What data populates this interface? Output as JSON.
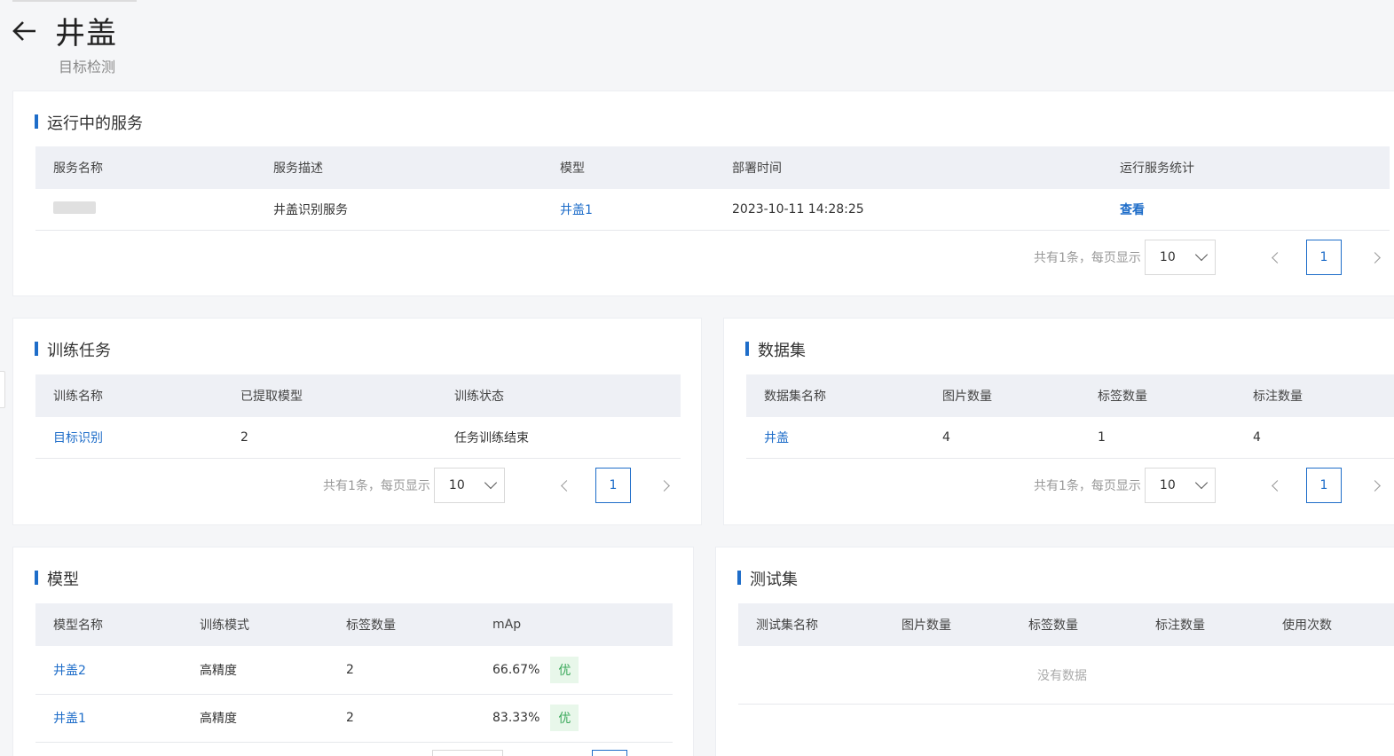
{
  "header": {
    "title": "井盖",
    "subtitle": "目标检测"
  },
  "services": {
    "title": "运行中的服务",
    "columns": [
      "服务名称",
      "服务描述",
      "模型",
      "部署时间",
      "运行服务统计"
    ],
    "rows": [
      {
        "name": "",
        "desc": "井盖识别服务",
        "model": "井盖1",
        "time": "2023-10-11 14:28:25",
        "stats": "查看"
      }
    ],
    "pager": {
      "total": "共有1条，每页显示",
      "size": "10",
      "page": "1"
    }
  },
  "training": {
    "title": "训练任务",
    "columns": [
      "训练名称",
      "已提取模型",
      "训练状态"
    ],
    "rows": [
      {
        "name": "目标识别",
        "models": "2",
        "status": "任务训练结束"
      }
    ],
    "pager": {
      "total": "共有1条，每页显示",
      "size": "10",
      "page": "1"
    }
  },
  "datasets": {
    "title": "数据集",
    "columns": [
      "数据集名称",
      "图片数量",
      "标签数量",
      "标注数量"
    ],
    "rows": [
      {
        "name": "井盖",
        "images": "4",
        "labels": "1",
        "annotations": "4"
      }
    ],
    "pager": {
      "total": "共有1条，每页显示",
      "size": "10",
      "page": "1"
    }
  },
  "models": {
    "title": "模型",
    "columns": [
      "模型名称",
      "训练模式",
      "标签数量",
      "mAp"
    ],
    "rows": [
      {
        "name": "井盖2",
        "mode": "高精度",
        "labels": "2",
        "map": "66.67%",
        "grade": "优"
      },
      {
        "name": "井盖1",
        "mode": "高精度",
        "labels": "2",
        "map": "83.33%",
        "grade": "优"
      }
    ]
  },
  "testsets": {
    "title": "测试集",
    "columns": [
      "测试集名称",
      "图片数量",
      "标签数量",
      "标注数量",
      "使用次数"
    ],
    "empty": "没有数据"
  },
  "colors": {
    "accent": "#1e6dc9",
    "badge_bg": "#e8f7ea",
    "badge_text": "#3aa85a"
  }
}
